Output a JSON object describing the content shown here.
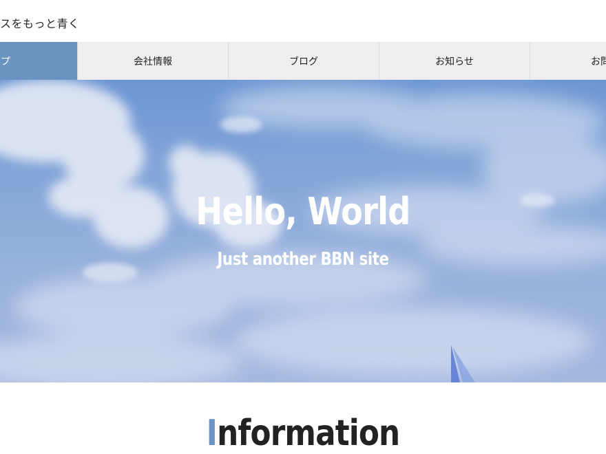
{
  "site": {
    "title": "スをもっと青く"
  },
  "nav": {
    "items": [
      {
        "label": "ップ",
        "active": true
      },
      {
        "label": "会社情報",
        "active": false
      },
      {
        "label": "ブログ",
        "active": false
      },
      {
        "label": "お知らせ",
        "active": false
      },
      {
        "label": "お問い",
        "active": false
      }
    ]
  },
  "hero": {
    "title": "Hello, World",
    "subtitle": "Just another BBN site"
  },
  "information": {
    "first_letter": "I",
    "rest": "nformation"
  },
  "colors": {
    "accent": "#6b93c2",
    "nav_bg": "#eeeeee",
    "sky": "#7da3d8"
  }
}
